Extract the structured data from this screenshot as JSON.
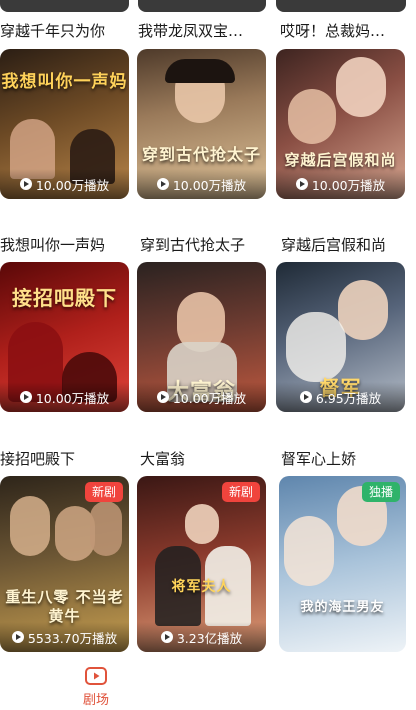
{
  "top_row": {
    "partial_label": "10.00万播放"
  },
  "rows": [
    {
      "titles": [
        "穿越千年只为你",
        "我带龙凤双宝…",
        "哎呀！总裁妈…"
      ],
      "cards": [
        {
          "poster_text": "我想叫你一声妈",
          "plays": "10.00万播放",
          "colors": [
            "#3b2a1d",
            "#9c6a2c"
          ]
        },
        {
          "poster_text": "穿到古代抢太子",
          "plays": "10.00万播放",
          "colors": [
            "#6b5540",
            "#d9b98b"
          ]
        },
        {
          "poster_text": "穿越后宫假和尚",
          "plays": "10.00万播放",
          "colors": [
            "#4a2b26",
            "#c98f7a"
          ]
        }
      ]
    },
    {
      "titles": [
        "我想叫你一声妈",
        "穿到古代抢太子",
        "穿越后宫假和尚"
      ],
      "cards": [
        {
          "poster_text": "接招吧殿下",
          "plays": "10.00万播放",
          "colors": [
            "#7a0d0d",
            "#d6322b"
          ]
        },
        {
          "poster_text": "大富翁",
          "plays": "10.00万播放",
          "colors": [
            "#2d2623",
            "#a84a3a"
          ]
        },
        {
          "poster_text": "督军",
          "plays": "6.95万播放",
          "colors": [
            "#26323e",
            "#8b96a6"
          ]
        }
      ]
    },
    {
      "titles": [
        "接招吧殿下",
        "大富翁",
        "督军心上娇"
      ],
      "cards": [
        {
          "poster_text": "重生八零 不当老黄牛",
          "plays": "5533.70万播放",
          "badge": "新剧",
          "colors": [
            "#3c3122",
            "#b08b3e"
          ]
        },
        {
          "poster_text": "将军夫人",
          "plays": "3.23亿播放",
          "badge": "新剧",
          "colors": [
            "#4a1f1c",
            "#c45b3f"
          ]
        },
        {
          "poster_text": "我的海王男友",
          "plays": "",
          "badge": "独播",
          "colors": [
            "#7fa5c9",
            "#e5eef5"
          ]
        }
      ]
    }
  ],
  "tabbar": {
    "active_tab": "剧场",
    "accent": "#e0533b"
  }
}
